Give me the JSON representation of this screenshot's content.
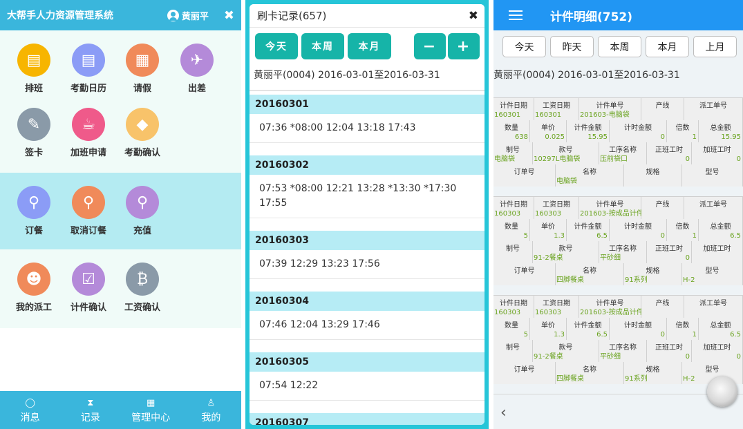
{
  "panel1": {
    "title": "大帮手人力资源管理系统",
    "username": "黄丽平",
    "close_glyph": "✖",
    "sections": [
      {
        "items": [
          {
            "label": "排班",
            "icon": "schedule-icon",
            "color": "#f7b500",
            "glyph": "▤"
          },
          {
            "label": "考勤日历",
            "icon": "calendar-list-icon",
            "color": "#8b9cf6",
            "glyph": "▤"
          },
          {
            "label": "请假",
            "icon": "calendar-icon",
            "color": "#f08a5a",
            "glyph": "▦"
          },
          {
            "label": "出差",
            "icon": "airplane-icon",
            "color": "#b48ad9",
            "glyph": "✈"
          },
          {
            "label": "签卡",
            "icon": "edit-icon",
            "color": "#8a9aa8",
            "glyph": "✎"
          },
          {
            "label": "加班申请",
            "icon": "coffee-cup-icon",
            "color": "#ef5a8a",
            "glyph": "☕"
          },
          {
            "label": "考勤确认",
            "icon": "tag-icon",
            "color": "#f8c36a",
            "glyph": "◆"
          }
        ]
      },
      {
        "items": [
          {
            "label": "订餐",
            "icon": "spoon-icon",
            "color": "#8b9cf6",
            "glyph": "⚲"
          },
          {
            "label": "取消订餐",
            "icon": "spoon-icon",
            "color": "#f08a5a",
            "glyph": "⚲"
          },
          {
            "label": "充值",
            "icon": "spoon-icon",
            "color": "#b48ad9",
            "glyph": "⚲"
          }
        ]
      },
      {
        "items": [
          {
            "label": "我的派工",
            "icon": "user-icon",
            "color": "#f08a5a",
            "glyph": "☻"
          },
          {
            "label": "计件确认",
            "icon": "calendar-check-icon",
            "color": "#b48ad9",
            "glyph": "☑"
          },
          {
            "label": "工资确认",
            "icon": "bitcoin-icon",
            "color": "#8a9aa8",
            "glyph": "₿"
          }
        ]
      }
    ],
    "tabbar": [
      {
        "label": "消息",
        "icon": "chat-icon",
        "glyph": "◯"
      },
      {
        "label": "记录",
        "icon": "hourglass-icon",
        "glyph": "⧗"
      },
      {
        "label": "管理中心",
        "icon": "grid-icon",
        "glyph": "▦"
      },
      {
        "label": "我的",
        "icon": "person-icon",
        "glyph": "♙"
      }
    ]
  },
  "panel2": {
    "title": "刷卡记录(657)",
    "close_glyph": "✖",
    "buttons": [
      "今天",
      "本周",
      "本月"
    ],
    "minus": "−",
    "plus": "+",
    "person": "黄丽平(0004) 2016-03-01至2016-03-31",
    "days": [
      {
        "date": "20160301",
        "times": "07:36 *08:00  12:04  13:18  17:43"
      },
      {
        "date": "20160302",
        "times": "07:53 *08:00  12:21  13:28 *13:30 *17:30  17:55"
      },
      {
        "date": "20160303",
        "times": "07:39  12:29  13:23  17:56"
      },
      {
        "date": "20160304",
        "times": "07:46  12:04  13:29  17:46"
      },
      {
        "date": "20160305",
        "times": "07:54  12:22"
      },
      {
        "date": "20160307",
        "times": ""
      }
    ]
  },
  "panel3": {
    "title": "计件明细(752)",
    "buttons": [
      "今天",
      "昨天",
      "本周",
      "本月",
      "上月"
    ],
    "person": "黄丽平(0004) 2016-03-01至2016-03-31",
    "back_glyph": "‹",
    "labels": {
      "piece_date": "计件日期",
      "wage_date": "工资日期",
      "piece_no": "计件单号",
      "line": "产线",
      "dispatch_no": "派工单号",
      "qty": "数量",
      "price": "单价",
      "piece_amt": "计件金额",
      "time_amt": "计时金额",
      "multiple": "倍数",
      "total": "总金额",
      "make_no": "制号",
      "style_no": "款号",
      "process": "工序名称",
      "normal_hours": "正班工时",
      "overtime_hours": "加班工时",
      "order_no": "订单号",
      "name": "名称",
      "spec": "规格",
      "model": "型号"
    },
    "records": [
      {
        "piece_date": "160301",
        "wage_date": "160301",
        "piece_no": "201603-电脑袋",
        "line": "",
        "dispatch_no": "",
        "qty": "638",
        "price": "0.025",
        "piece_amt": "15.95",
        "time_amt": "0",
        "multiple": "1",
        "total": "15.95",
        "make_no": "电脑袋",
        "style_no": "10297L电脑袋",
        "process": "压前袋口",
        "normal_hours": "0",
        "overtime_hours": "0",
        "order_no": "",
        "name": "电脑袋",
        "spec": "",
        "model": ""
      },
      {
        "piece_date": "160303",
        "wage_date": "160303",
        "piece_no": "201603-按成品计件",
        "line": "",
        "dispatch_no": "",
        "qty": "5",
        "price": "1.3",
        "piece_amt": "6.5",
        "time_amt": "0",
        "multiple": "1",
        "total": "6.5",
        "make_no": "",
        "style_no": "91-2餐桌",
        "process": "平砂细",
        "normal_hours": "0",
        "overtime_hours": "",
        "order_no": "",
        "name": "四脚餐桌",
        "spec": "91系列",
        "model": "H-2"
      },
      {
        "piece_date": "160303",
        "wage_date": "160303",
        "piece_no": "201603-按成品计件",
        "line": "",
        "dispatch_no": "",
        "qty": "5",
        "price": "1.3",
        "piece_amt": "6.5",
        "time_amt": "0",
        "multiple": "1",
        "total": "6.5",
        "make_no": "",
        "style_no": "91-2餐桌",
        "process": "平砂细",
        "normal_hours": "0",
        "overtime_hours": "0",
        "order_no": "",
        "name": "四脚餐桌",
        "spec": "91系列",
        "model": "H-2"
      }
    ]
  }
}
